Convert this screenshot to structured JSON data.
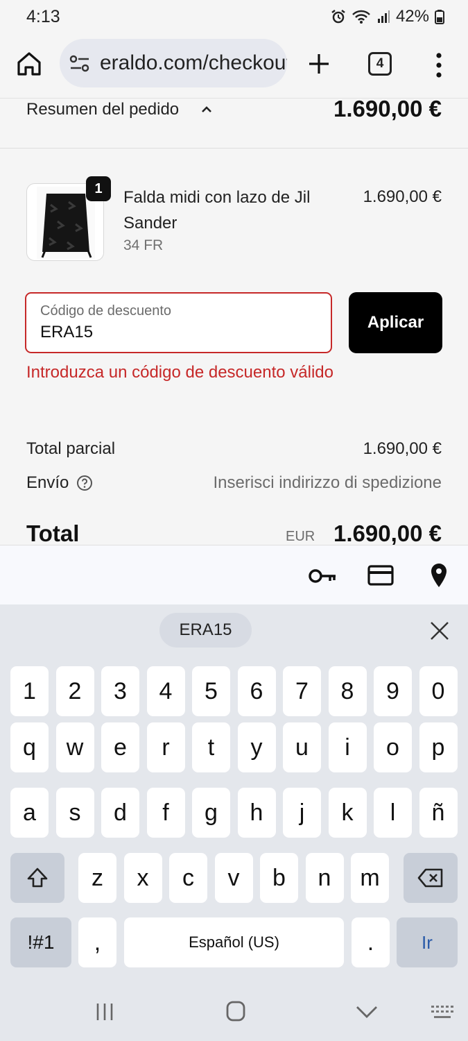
{
  "status_bar": {
    "time": "4:13",
    "battery": "42%"
  },
  "browser": {
    "url": "eraldo.com/checkout",
    "tab_count": "4"
  },
  "order_summary": {
    "label": "Resumen del pedido",
    "total": "1.690,00 €"
  },
  "product": {
    "quantity": "1",
    "name": "Falda midi con lazo de Jil Sander",
    "variant": "34 FR",
    "price": "1.690,00 €"
  },
  "discount": {
    "label": "Código de descuento",
    "value": "ERA15",
    "apply_label": "Aplicar",
    "error": "Introduzca un código de descuento válido"
  },
  "totals": {
    "subtotal_label": "Total parcial",
    "subtotal_value": "1.690,00 €",
    "shipping_label": "Envío",
    "shipping_value": "Inserisci indirizzo di spedizione",
    "total_label": "Total",
    "currency": "EUR",
    "total_value": "1.690,00 €"
  },
  "keyboard": {
    "suggestion": "ERA15",
    "number_row": [
      "1",
      "2",
      "3",
      "4",
      "5",
      "6",
      "7",
      "8",
      "9",
      "0"
    ],
    "row1": [
      "q",
      "w",
      "e",
      "r",
      "t",
      "y",
      "u",
      "i",
      "o",
      "p"
    ],
    "row2": [
      "a",
      "s",
      "d",
      "f",
      "g",
      "h",
      "j",
      "k",
      "l",
      "ñ"
    ],
    "row3": [
      "z",
      "x",
      "c",
      "v",
      "b",
      "n",
      "m"
    ],
    "symbols_label": "!#1",
    "comma": ",",
    "space_label": "Español (US)",
    "period": ".",
    "enter_label": "Ir"
  },
  "colors": {
    "error": "#c62828",
    "button_bg": "#000000",
    "page_bg": "#f5f5f5",
    "keyboard_bg": "#e4e7ec"
  }
}
